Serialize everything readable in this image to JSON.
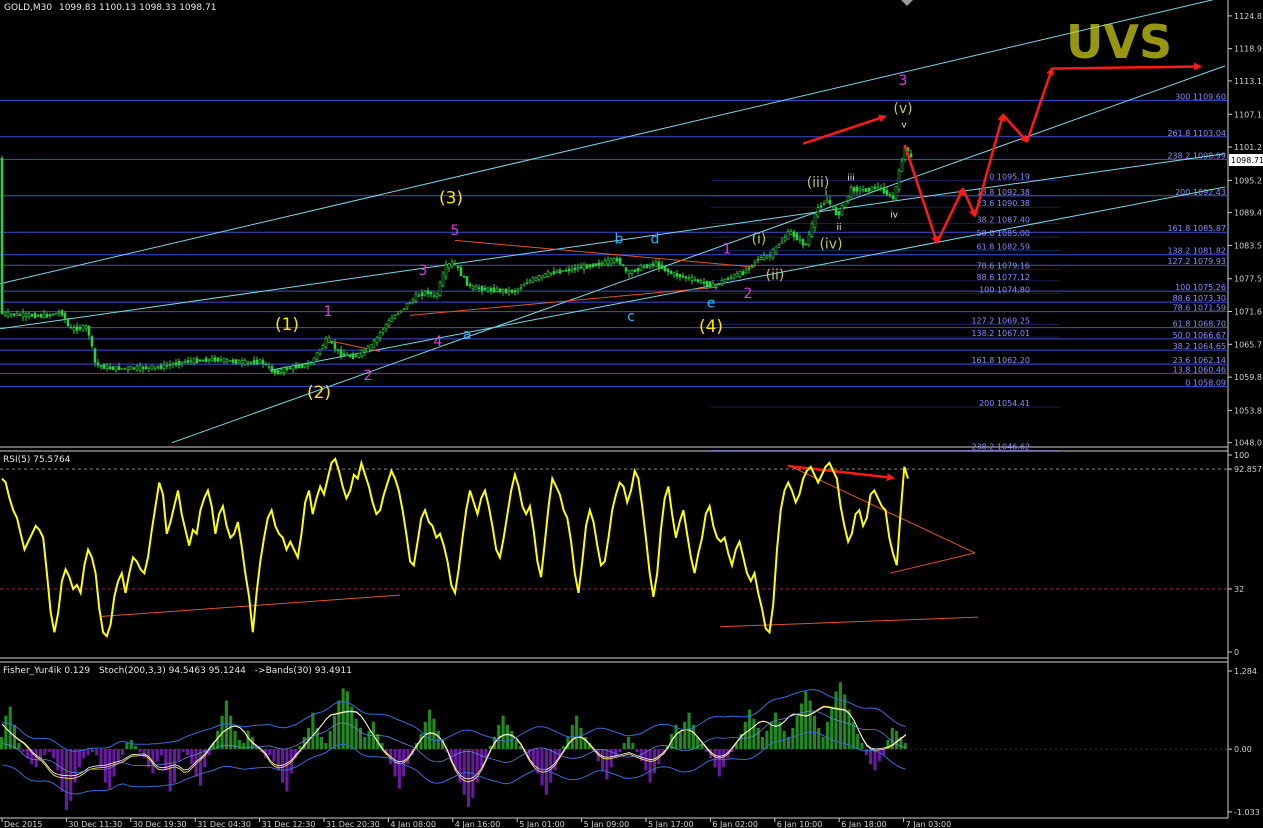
{
  "header": {
    "symbol": "GOLD,M30",
    "ohlc": "1099.83 1100.13 1098.33 1098.71",
    "rsi": "RSI(5) 75.5764",
    "fisher": "Fisher_Yur4ik 0.129",
    "stoch": "Stoch(200,3,3) 94.5463 95.1244",
    "bands": "->Bands(30) 93.4911",
    "logo": "UVS"
  },
  "colors": {
    "background": "#000000",
    "candle": "#2ecc40",
    "hline": "#3c4fd6",
    "fib_text": "#8a8aff",
    "channel": "#7fd6e6",
    "trend": "#e0522e",
    "arrow": "#ff1a1a",
    "rsi": "#ffff00",
    "hist_pos": "#1f8a1f",
    "hist_neg": "#6a1aa0",
    "wave_yellow": "#ffe500",
    "wave_magenta": "#e03ae0",
    "wave_cyan": "#29b6f6",
    "wave_olive": "#b7c75a"
  },
  "chart_data": [
    {
      "type": "line",
      "title": "GOLD,M30",
      "y_axis_ticks": [
        "1124.8",
        "1118.9",
        "1113.1",
        "1107.1",
        "1101.2",
        "1095.2",
        "1089.4",
        "1083.5",
        "1077.5",
        "1071.6",
        "1065.7",
        "1059.8",
        "1053.8",
        "1048.0"
      ],
      "ylim": [
        1047.4,
        1127.3
      ],
      "current_price": "1098.71",
      "x_axis_ticks": [
        "Dec 2015",
        "30 Dec 11:30",
        "30 Dec 19:30",
        "31 Dec 04:30",
        "31 Dec 12:30",
        "31 Dec 20:30",
        "4 Jan 08:00",
        "4 Jan 16:00",
        "5 Jan 01:00",
        "5 Jan 09:00",
        "5 Jan 17:00",
        "6 Jan 02:00",
        "6 Jan 10:00",
        "6 Jan 18:00",
        "7 Jan 03:00"
      ],
      "price_path": [
        [
          0,
          1071.2
        ],
        [
          20,
          1071.0
        ],
        [
          45,
          1070.8
        ],
        [
          62,
          1071.5
        ],
        [
          70,
          1068.4
        ],
        [
          88,
          1068.8
        ],
        [
          96,
          1062.0
        ],
        [
          110,
          1061.4
        ],
        [
          135,
          1061.4
        ],
        [
          160,
          1061.6
        ],
        [
          185,
          1062.6
        ],
        [
          215,
          1063.0
        ],
        [
          245,
          1062.4
        ],
        [
          262,
          1062.6
        ],
        [
          275,
          1060.6
        ],
        [
          290,
          1061.5
        ],
        [
          310,
          1062.0
        ],
        [
          328,
          1066.8
        ],
        [
          340,
          1064.0
        ],
        [
          355,
          1063.4
        ],
        [
          372,
          1065.4
        ],
        [
          386,
          1069.2
        ],
        [
          402,
          1072.0
        ],
        [
          418,
          1074.5
        ],
        [
          428,
          1075.2
        ],
        [
          436,
          1074.0
        ],
        [
          446,
          1079.6
        ],
        [
          454,
          1080.5
        ],
        [
          462,
          1078.2
        ],
        [
          470,
          1076.0
        ],
        [
          490,
          1075.5
        ],
        [
          515,
          1075.2
        ],
        [
          528,
          1077.0
        ],
        [
          550,
          1078.5
        ],
        [
          575,
          1079.3
        ],
        [
          600,
          1080.2
        ],
        [
          618,
          1081.0
        ],
        [
          628,
          1078.4
        ],
        [
          642,
          1079.6
        ],
        [
          656,
          1080.2
        ],
        [
          672,
          1078.4
        ],
        [
          700,
          1077.0
        ],
        [
          714,
          1076.2
        ],
        [
          728,
          1077.6
        ],
        [
          745,
          1078.7
        ],
        [
          756,
          1081.0
        ],
        [
          770,
          1081.6
        ],
        [
          790,
          1086.0
        ],
        [
          806,
          1083.4
        ],
        [
          818,
          1090.2
        ],
        [
          828,
          1091.7
        ],
        [
          838,
          1088.8
        ],
        [
          852,
          1093.7
        ],
        [
          866,
          1093.4
        ],
        [
          878,
          1094.1
        ],
        [
          894,
          1091.9
        ],
        [
          902,
          1098.6
        ],
        [
          906,
          1101.8
        ],
        [
          910,
          1099.2
        ]
      ],
      "fib_levels": [
        {
          "label": "300 1109.60",
          "y": 1109.6,
          "side": "right"
        },
        {
          "label": "261.8 1103.04",
          "y": 1103.04,
          "side": "right"
        },
        {
          "label": "238.2 1098.99",
          "y": 1098.99,
          "side": "right"
        },
        {
          "label": "200 1092.43",
          "y": 1092.43,
          "side": "right"
        },
        {
          "label": "161.8 1085.87",
          "y": 1085.87,
          "side": "right"
        },
        {
          "label": "138.2 1081.82",
          "y": 1081.82,
          "side": "right"
        },
        {
          "label": "127.2 1079.93",
          "y": 1079.93,
          "side": "right"
        },
        {
          "label": "100 1075.26",
          "y": 1075.26,
          "side": "right"
        },
        {
          "label": "88.6 1073.30",
          "y": 1073.3,
          "side": "right"
        },
        {
          "label": "78.6 1071.59",
          "y": 1071.59,
          "side": "right"
        },
        {
          "label": "61.8 1068.70",
          "y": 1068.7,
          "side": "right"
        },
        {
          "label": "50.0 1066.67",
          "y": 1066.67,
          "side": "right"
        },
        {
          "label": "38.2 1064.65",
          "y": 1064.65,
          "side": "right"
        },
        {
          "label": "23.6 1062.14",
          "y": 1062.14,
          "side": "right"
        },
        {
          "label": "13.8 1060.46",
          "y": 1060.46,
          "side": "right"
        },
        {
          "label": "0 1058.09",
          "y": 1058.09,
          "side": "right"
        },
        {
          "label": "0 1095.19",
          "y": 1095.19,
          "side": "mid"
        },
        {
          "label": "13.8 1092.38",
          "y": 1092.38,
          "side": "mid"
        },
        {
          "label": "23.6 1090.38",
          "y": 1090.38,
          "side": "mid"
        },
        {
          "label": "38.2 1087.40",
          "y": 1087.4,
          "side": "mid"
        },
        {
          "label": "50.0 1085.00",
          "y": 1085.0,
          "side": "mid"
        },
        {
          "label": "61.8 1082.59",
          "y": 1082.59,
          "side": "mid"
        },
        {
          "label": "78.6 1079.16",
          "y": 1079.16,
          "side": "mid"
        },
        {
          "label": "88.6 1077.12",
          "y": 1077.12,
          "side": "mid"
        },
        {
          "label": "100 1074.80",
          "y": 1074.8,
          "side": "mid"
        },
        {
          "label": "127.2 1069.25",
          "y": 1069.25,
          "side": "mid"
        },
        {
          "label": "138.2 1067.01",
          "y": 1067.01,
          "side": "mid"
        },
        {
          "label": "161.8 1062.20",
          "y": 1062.2,
          "side": "mid"
        },
        {
          "label": "200 1054.41",
          "y": 1054.41,
          "side": "mid"
        },
        {
          "label": "238.2 1046.62",
          "y": 1046.62,
          "side": "mid"
        }
      ],
      "wave_labels": [
        {
          "t": "(1)",
          "x": 287,
          "y": 1068.3,
          "c": "yellow",
          "big": true
        },
        {
          "t": "(2)",
          "x": 319,
          "y": 1056.0,
          "c": "yellow",
          "big": true
        },
        {
          "t": "(3)",
          "x": 451,
          "y": 1091.0,
          "c": "yellow",
          "big": true
        },
        {
          "t": "(4)",
          "x": 711,
          "y": 1067.9,
          "c": "yellow",
          "big": true
        },
        {
          "t": "1",
          "x": 328,
          "y": 1070.8,
          "c": "magenta"
        },
        {
          "t": "2",
          "x": 368,
          "y": 1059.3,
          "c": "magenta"
        },
        {
          "t": "3",
          "x": 423,
          "y": 1078.2,
          "c": "magenta"
        },
        {
          "t": "4",
          "x": 438,
          "y": 1065.4,
          "c": "magenta"
        },
        {
          "t": "5",
          "x": 455,
          "y": 1085.4,
          "c": "magenta"
        },
        {
          "t": "1",
          "x": 727,
          "y": 1082.0,
          "c": "magenta"
        },
        {
          "t": "2",
          "x": 748,
          "y": 1074.0,
          "c": "magenta"
        },
        {
          "t": "3",
          "x": 903,
          "y": 1112.4,
          "c": "magenta"
        },
        {
          "t": "a",
          "x": 467,
          "y": 1066.7,
          "c": "cyan"
        },
        {
          "t": "b",
          "x": 619,
          "y": 1083.8,
          "c": "cyan"
        },
        {
          "t": "c",
          "x": 631,
          "y": 1069.9,
          "c": "cyan"
        },
        {
          "t": "d",
          "x": 655,
          "y": 1083.8,
          "c": "cyan"
        },
        {
          "t": "e",
          "x": 711,
          "y": 1072.3,
          "c": "cyan"
        },
        {
          "t": "(i)",
          "x": 759,
          "y": 1083.8,
          "c": "olive"
        },
        {
          "t": "(ii)",
          "x": 775,
          "y": 1077.4,
          "c": "olive"
        },
        {
          "t": "(iii)",
          "x": 818,
          "y": 1094.0,
          "c": "olive"
        },
        {
          "t": "(iv)",
          "x": 831,
          "y": 1082.9,
          "c": "olive"
        },
        {
          "t": "(v)",
          "x": 903,
          "y": 1107.3,
          "c": "olive"
        },
        {
          "t": "i",
          "x": 826,
          "y": 1092.6,
          "c": "white"
        },
        {
          "t": "ii",
          "x": 839,
          "y": 1086.3,
          "c": "white"
        },
        {
          "t": "iii",
          "x": 851,
          "y": 1095.2,
          "c": "white"
        },
        {
          "t": "iv",
          "x": 894,
          "y": 1088.5,
          "c": "white"
        },
        {
          "t": "v",
          "x": 904,
          "y": 1104.7,
          "c": "white"
        }
      ],
      "forecast_path": [
        [
          905,
          1101.4
        ],
        [
          937,
          1084.0
        ],
        [
          963,
          1093.7
        ],
        [
          975,
          1088.8
        ],
        [
          1003,
          1107.0
        ],
        [
          1027,
          1102.2
        ],
        [
          1052,
          1115.3
        ],
        [
          1200,
          1115.7
        ]
      ],
      "channel_lines": [
        [
          [
            0,
            1076.6
          ],
          [
            1220,
            1128.0
          ]
        ],
        [
          [
            172,
            1048.0
          ],
          [
            1225,
            1115.8
          ]
        ],
        [
          [
            0,
            1068.5
          ],
          [
            1225,
            1100.0
          ]
        ],
        [
          [
            270,
            1061.0
          ],
          [
            1225,
            1094.0
          ]
        ]
      ],
      "trend_lines": [
        [
          [
            455,
            1084.4
          ],
          [
            755,
            1079.6
          ]
        ],
        [
          [
            410,
            1070.9
          ],
          [
            718,
            1076.0
          ]
        ],
        [
          [
            328,
            1066.4
          ],
          [
            380,
            1064.4
          ]
        ]
      ],
      "extra_arrow": [
        [
          803,
          1101.8
        ],
        [
          885,
          1106.7
        ]
      ]
    },
    {
      "type": "line",
      "title": "RSI(5) 75.5764",
      "y_axis_ticks": [
        "100",
        "92.857",
        "32",
        "0"
      ],
      "ylim": [
        0,
        100
      ],
      "levels": [
        92.857,
        32
      ],
      "values": [
        88,
        86,
        78,
        72,
        68,
        60,
        52,
        56,
        60,
        64,
        62,
        58,
        40,
        20,
        10,
        20,
        36,
        42,
        38,
        32,
        34,
        30,
        44,
        52,
        48,
        40,
        22,
        10,
        8,
        14,
        28,
        36,
        40,
        30,
        40,
        48,
        46,
        42,
        40,
        48,
        62,
        74,
        86,
        80,
        60,
        66,
        74,
        82,
        70,
        62,
        54,
        62,
        60,
        72,
        78,
        82,
        74,
        60,
        70,
        74,
        64,
        58,
        60,
        66,
        54,
        40,
        28,
        10,
        30,
        46,
        58,
        68,
        72,
        64,
        60,
        58,
        52,
        56,
        52,
        48,
        60,
        76,
        82,
        70,
        78,
        84,
        80,
        88,
        96,
        98,
        92,
        84,
        78,
        82,
        90,
        88,
        96,
        90,
        84,
        76,
        70,
        72,
        80,
        86,
        92,
        88,
        82,
        72,
        60,
        46,
        44,
        56,
        68,
        72,
        66,
        64,
        58,
        60,
        54,
        46,
        34,
        30,
        42,
        58,
        72,
        82,
        76,
        70,
        78,
        82,
        74,
        64,
        52,
        48,
        58,
        70,
        82,
        90,
        84,
        74,
        70,
        74,
        62,
        46,
        38,
        56,
        74,
        88,
        84,
        80,
        72,
        68,
        56,
        40,
        30,
        46,
        64,
        72,
        66,
        54,
        44,
        46,
        58,
        72,
        80,
        86,
        84,
        76,
        82,
        92,
        88,
        74,
        58,
        40,
        28,
        40,
        62,
        78,
        84,
        70,
        58,
        66,
        72,
        60,
        48,
        40,
        50,
        58,
        70,
        74,
        64,
        58,
        56,
        58,
        50,
        44,
        52,
        56,
        48,
        40,
        36,
        40,
        30,
        22,
        12,
        10,
        24,
        52,
        72,
        82,
        86,
        82,
        76,
        80,
        88,
        92,
        94,
        90,
        86,
        90,
        94,
        96,
        92,
        88,
        74,
        64,
        56,
        60,
        70,
        72,
        64,
        68,
        80,
        82,
        78,
        74,
        72,
        58,
        50,
        44,
        70,
        94,
        88
      ],
      "trend_lines": [
        [
          [
            100,
            18.0
          ],
          [
            400,
            28.9
          ]
        ],
        [
          [
            720,
            12.8
          ],
          [
            978,
            17.7
          ]
        ],
        [
          [
            790,
            94.4
          ],
          [
            975,
            50.3
          ]
        ],
        [
          [
            890,
            40.0
          ],
          [
            975,
            50.3
          ]
        ]
      ],
      "arrow": [
        [
          788,
          94.4
        ],
        [
          893,
          88.4
        ]
      ]
    },
    {
      "type": "bar",
      "title": "Fisher_Yur4ik 0.129",
      "y_axis_ticks": [
        "1.284",
        "0.00",
        "-1.033"
      ],
      "ylim": [
        -1.1,
        1.4
      ],
      "histogram": [
        0.2,
        0.55,
        0.7,
        0.4,
        0.1,
        -0.05,
        -0.15,
        -0.25,
        -0.3,
        -0.2,
        -0.1,
        -0.05,
        -0.15,
        -0.35,
        -0.7,
        -1.0,
        -0.85,
        -0.55,
        -0.3,
        -0.15,
        -0.1,
        -0.05,
        -0.1,
        -0.3,
        -0.55,
        -0.65,
        -0.45,
        -0.25,
        -0.1,
        0.1,
        0.15,
        0.05,
        -0.05,
        -0.15,
        -0.3,
        -0.4,
        -0.2,
        -0.1,
        -0.35,
        -0.7,
        -0.55,
        -0.2,
        -0.05,
        -0.1,
        -0.25,
        -0.45,
        -0.6,
        -0.3,
        -0.1,
        0.1,
        0.3,
        0.55,
        0.8,
        0.55,
        0.3,
        0.15,
        0.1,
        0.3,
        0.2,
        0.05,
        -0.05,
        -0.15,
        -0.1,
        -0.2,
        -0.35,
        -0.55,
        -0.7,
        -0.4,
        -0.15,
        0.05,
        0.2,
        0.35,
        0.6,
        0.35,
        0.2,
        0.1,
        0.3,
        0.55,
        0.8,
        1.0,
        0.95,
        0.7,
        0.5,
        0.35,
        0.2,
        0.3,
        0.45,
        0.25,
        0.1,
        -0.1,
        -0.25,
        -0.45,
        -0.65,
        -0.45,
        -0.25,
        -0.1,
        0.1,
        0.25,
        0.45,
        0.65,
        0.5,
        0.3,
        0.15,
        -0.05,
        -0.2,
        -0.35,
        -0.55,
        -0.75,
        -0.95,
        -0.8,
        -0.55,
        -0.3,
        -0.15,
        0.05,
        0.2,
        0.4,
        0.55,
        0.4,
        0.3,
        0.15,
        0.05,
        -0.05,
        -0.15,
        -0.25,
        -0.4,
        -0.6,
        -0.75,
        -0.55,
        -0.35,
        -0.15,
        0.05,
        0.2,
        0.4,
        0.55,
        0.35,
        0.2,
        0.1,
        -0.05,
        -0.2,
        -0.35,
        -0.5,
        -0.3,
        -0.15,
        -0.05,
        0.1,
        0.2,
        0.1,
        -0.05,
        -0.2,
        -0.35,
        -0.55,
        -0.4,
        -0.25,
        -0.1,
        0.05,
        0.25,
        0.4,
        0.3,
        0.45,
        0.6,
        0.4,
        0.2,
        0.1,
        -0.05,
        -0.15,
        -0.3,
        -0.45,
        -0.3,
        -0.15,
        -0.05,
        0.1,
        0.25,
        0.45,
        0.65,
        0.5,
        0.35,
        0.2,
        0.3,
        0.45,
        0.6,
        0.45,
        0.3,
        0.2,
        0.35,
        0.55,
        0.75,
        0.95,
        0.8,
        0.55,
        0.35,
        0.2,
        0.45,
        0.7,
        0.95,
        1.1,
        0.9,
        0.65,
        0.45,
        0.25,
        0.1,
        -0.1,
        -0.25,
        -0.35,
        -0.2,
        -0.1,
        0.15,
        0.35,
        0.3,
        0.2,
        0.1
      ]
    }
  ]
}
